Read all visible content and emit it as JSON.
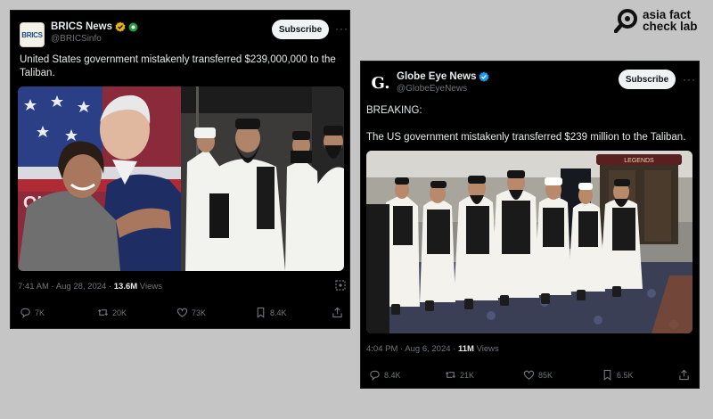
{
  "brand": {
    "name_line1": "asia fact",
    "name_line2": "check lab"
  },
  "posts": [
    {
      "avatar_text": "BRICS",
      "display_name": "BRICS News",
      "handle": "@BRICSinfo",
      "subscribe_label": "Subscribe",
      "more_label": "···",
      "text": "United States government mistakenly transferred $239,000,000 to the Taliban.",
      "timestamp": "7:41 AM · Aug 28, 2024 · ",
      "views_count": "13.6M",
      "views_label": " Views",
      "replies": "7K",
      "reposts": "20K",
      "likes": "73K",
      "bookmarks": "8.4K"
    },
    {
      "avatar_text": "G.",
      "display_name": "Globe Eye News",
      "handle": "@GlobeEyeNews",
      "subscribe_label": "Subscribe",
      "more_label": "···",
      "text_line1": "BREAKING:",
      "text_line2": "The US government mistakenly transferred $239 million to the Taliban.",
      "timestamp": "4:04 PM · Aug 6, 2024 · ",
      "views_count": "11M",
      "views_label": " Views",
      "replies": "8.4K",
      "reposts": "21K",
      "likes": "85K",
      "bookmarks": "6.5K"
    }
  ],
  "media": {
    "sign_text": "LEGENDS"
  },
  "colors": {
    "card_bg": "#000000",
    "muted": "#71767b",
    "verified_gold": "#e8b11b",
    "verified_blue": "#1d9bf0",
    "page_bg": "#c5c5c5"
  }
}
